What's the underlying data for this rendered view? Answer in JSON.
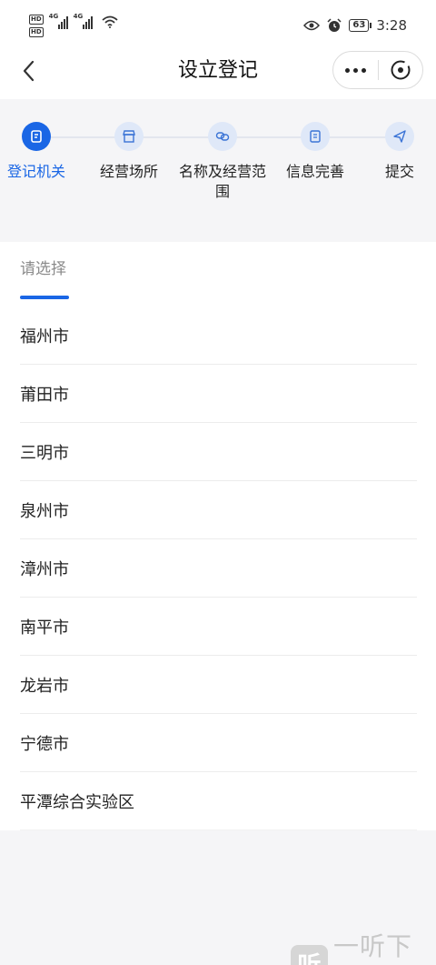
{
  "status_bar": {
    "hd1": "HD",
    "hd2": "HD",
    "net1": "4G",
    "net2": "4G",
    "battery": "63",
    "time": "3:28"
  },
  "nav": {
    "title": "设立登记",
    "back_icon": "chevron-left-icon",
    "more_icon": "more-icon",
    "close_icon": "close-circle-icon"
  },
  "steps": [
    {
      "label": "登记机关",
      "icon": "document-icon",
      "active": true
    },
    {
      "label": "经营场所",
      "icon": "shop-icon",
      "active": false
    },
    {
      "label": "名称及经营范围",
      "icon": "link-icon",
      "active": false
    },
    {
      "label": "信息完善",
      "icon": "edit-document-icon",
      "active": false
    },
    {
      "label": "提交",
      "icon": "send-icon",
      "active": false
    }
  ],
  "colors": {
    "accent": "#1a66e5",
    "step_inactive_bg": "#dfe8f8"
  },
  "selector": {
    "tab_label": "请选择",
    "options": [
      "福州市",
      "莆田市",
      "三明市",
      "泉州市",
      "漳州市",
      "南平市",
      "龙岩市",
      "宁德市",
      "平潭综合实验区"
    ]
  },
  "watermark": {
    "logo_char": "听",
    "text": "一听下载"
  }
}
